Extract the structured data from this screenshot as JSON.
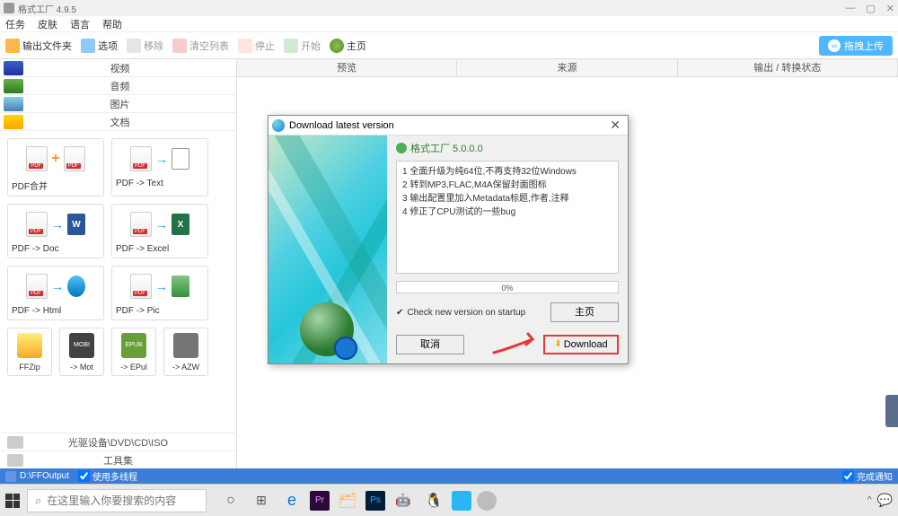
{
  "titlebar": {
    "appname": "格式工厂 4.9.5"
  },
  "menubar": {
    "items": [
      "任务",
      "皮肤",
      "语言",
      "帮助"
    ]
  },
  "toolbar": {
    "output_folder": "输出文件夹",
    "options": "选项",
    "remove": "移除",
    "clear_list": "清空列表",
    "stop": "停止",
    "start": "开始",
    "home": "主页",
    "upload": "拖拽上传"
  },
  "sidebar": {
    "categories": {
      "video": "视频",
      "audio": "音频",
      "image": "图片",
      "document": "文档"
    },
    "docs": [
      {
        "id": "pdf-merge",
        "label": "PDF合并"
      },
      {
        "id": "pdf-text",
        "label": "PDF -> Text"
      },
      {
        "id": "pdf-doc",
        "label": "PDF -> Doc"
      },
      {
        "id": "pdf-excel",
        "label": "PDF -> Excel"
      },
      {
        "id": "pdf-html",
        "label": "PDF -> Html"
      },
      {
        "id": "pdf-pic",
        "label": "PDF -> Pic"
      }
    ],
    "smalldocs": [
      {
        "id": "ffzip",
        "label": "FFZip"
      },
      {
        "id": "mobi",
        "label": "-> Mot"
      },
      {
        "id": "epub",
        "label": "-> EPul"
      },
      {
        "id": "azw",
        "label": "-> AZW"
      }
    ],
    "optical": "光驱设备\\DVD\\CD\\ISO",
    "toolset": "工具集"
  },
  "content_header": {
    "preview": "预览",
    "source": "来源",
    "status": "输出 / 转换状态"
  },
  "dialog": {
    "title": "Download latest version",
    "version_label": "格式工厂 5.0.0.0",
    "notes": [
      "1 全面升级为纯64位,不再支持32位Windows",
      "2 转到MP3,FLAC,M4A保留封面图标",
      "3 输出配置里加入Metadata标题,作者,注释",
      "4 修正了CPU测试的一些bug"
    ],
    "progress": "0%",
    "check_label": "Check new version on startup",
    "home_btn": "主页",
    "cancel_btn": "取消",
    "download_btn": "Download"
  },
  "statusbar": {
    "path": "D:\\FFOutput",
    "multithread": "使用多线程",
    "done": "完成通知"
  },
  "taskbar": {
    "search_placeholder": "在这里输入你要搜索的内容"
  }
}
